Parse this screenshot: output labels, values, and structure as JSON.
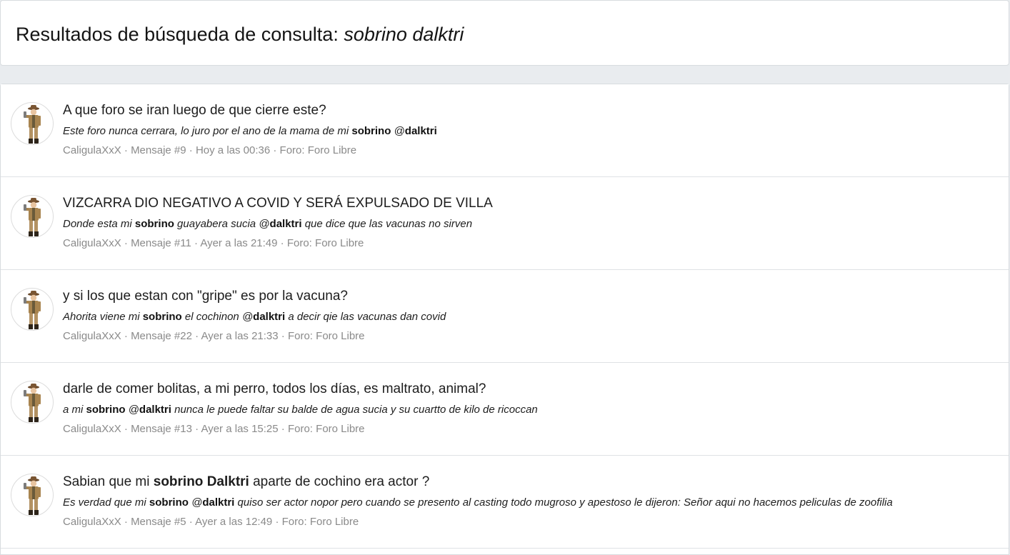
{
  "header": {
    "title_prefix": "Resultados de búsqueda de consulta:",
    "query": "sobrino dalktri"
  },
  "results": [
    {
      "title": "A que foro se iran luego de que cierre este?",
      "snippet": [
        {
          "t": "Este foro nunca cerrara, lo juro por el ano de la mama de mi ",
          "b": false
        },
        {
          "t": "sobrino",
          "b": true
        },
        {
          "t": " @",
          "b": false
        },
        {
          "t": "dalktri",
          "b": true
        }
      ],
      "author": "CaligulaXxX",
      "message": "Mensaje #9",
      "time": "Hoy a las 00:36",
      "forum_label": "Foro:",
      "forum": "Foro Libre"
    },
    {
      "title": "VIZCARRA DIO NEGATIVO A COVID Y SERÁ EXPULSADO DE VILLA",
      "snippet": [
        {
          "t": "Donde esta mi ",
          "b": false
        },
        {
          "t": "sobrino",
          "b": true
        },
        {
          "t": " guayabera sucia @",
          "b": false
        },
        {
          "t": "dalktri",
          "b": true
        },
        {
          "t": " que dice que las vacunas no sirven",
          "b": false
        }
      ],
      "author": "CaligulaXxX",
      "message": "Mensaje #11",
      "time": "Ayer a las 21:49",
      "forum_label": "Foro:",
      "forum": "Foro Libre"
    },
    {
      "title": "y si los que estan con \"gripe\" es por la vacuna?",
      "snippet": [
        {
          "t": "Ahorita viene mi ",
          "b": false
        },
        {
          "t": "sobrino",
          "b": true
        },
        {
          "t": " el cochinon @",
          "b": false
        },
        {
          "t": "dalktri",
          "b": true
        },
        {
          "t": " a decir qie las vacunas dan covid",
          "b": false
        }
      ],
      "author": "CaligulaXxX",
      "message": "Mensaje #22",
      "time": "Ayer a las 21:33",
      "forum_label": "Foro:",
      "forum": "Foro Libre"
    },
    {
      "title": "darle de comer bolitas, a mi perro, todos los días, es maltrato, animal?",
      "snippet": [
        {
          "t": "a mi ",
          "b": false
        },
        {
          "t": "sobrino",
          "b": true
        },
        {
          "t": " @",
          "b": false
        },
        {
          "t": "dalktri",
          "b": true
        },
        {
          "t": " nunca le puede faltar su balde de agua sucia y su cuartto de kilo de ricoccan",
          "b": false
        }
      ],
      "author": "CaligulaXxX",
      "message": "Mensaje #13",
      "time": "Ayer a las 15:25",
      "forum_label": "Foro:",
      "forum": "Foro Libre"
    },
    {
      "title_parts": [
        {
          "t": "Sabian que mi ",
          "b": false
        },
        {
          "t": "sobrino Dalktri",
          "b": true
        },
        {
          "t": " aparte de cochino era actor ?",
          "b": false
        }
      ],
      "snippet": [
        {
          "t": "Es verdad que mi ",
          "b": false
        },
        {
          "t": "sobrino",
          "b": true
        },
        {
          "t": " @",
          "b": false
        },
        {
          "t": "dalktri",
          "b": true
        },
        {
          "t": " quiso ser actor nopor pero cuando se presento al casting todo mugroso y apestoso le dijeron: Señor aqui no hacemos peliculas de zoofilia",
          "b": false
        }
      ],
      "author": "CaligulaXxX",
      "message": "Mensaje #5",
      "time": "Ayer a las 12:49",
      "forum_label": "Foro:",
      "forum": "Foro Libre"
    }
  ]
}
